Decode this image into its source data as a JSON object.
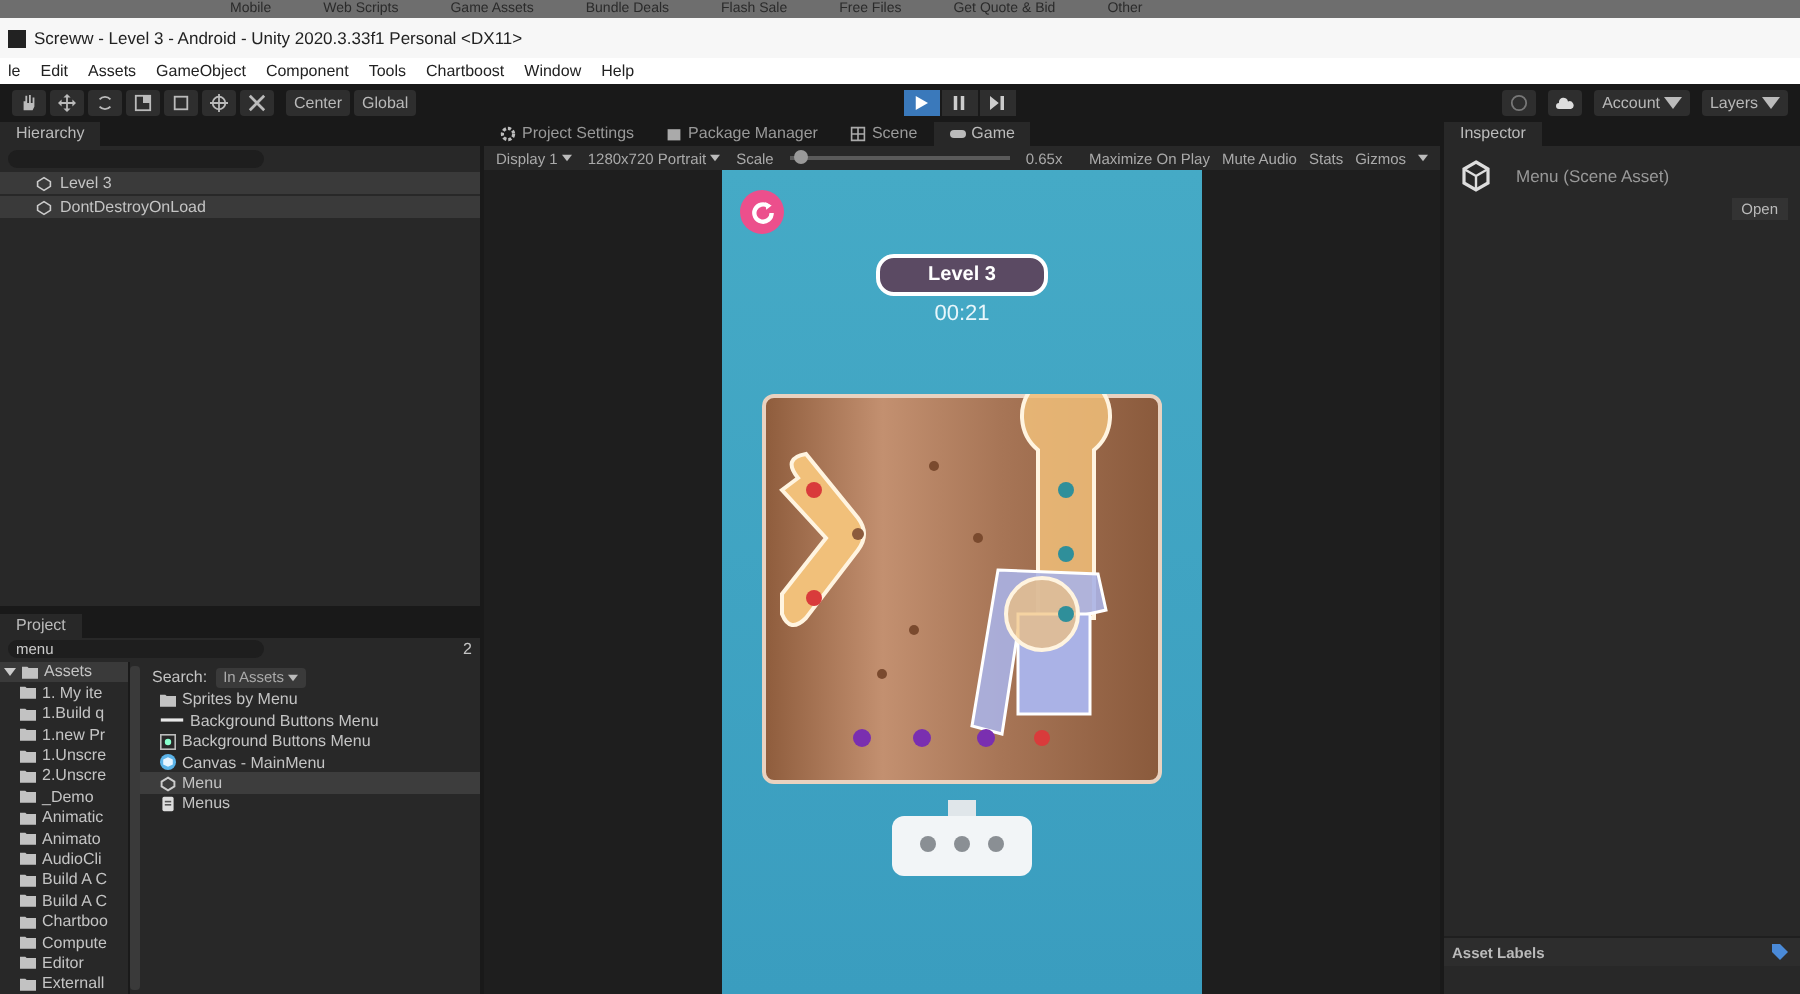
{
  "browser_bar": {
    "items": [
      "Mobile",
      "Web Scripts",
      "Game Assets",
      "Bundle Deals",
      "Flash Sale",
      "Free Files",
      "Get Quote & Bid",
      "Other"
    ]
  },
  "window": {
    "title": "Screww - Level 3 - Android - Unity 2020.3.33f1 Personal <DX11>"
  },
  "menu": [
    "le",
    "Edit",
    "Assets",
    "GameObject",
    "Component",
    "Tools",
    "Chartboost",
    "Window",
    "Help"
  ],
  "toolbar": {
    "pivot": "Center",
    "space": "Global",
    "playing": true,
    "account": "Account",
    "layers": "Layers"
  },
  "hierarchy": {
    "title": "Hierarchy",
    "items": [
      "Level 3",
      "DontDestroyOnLoad"
    ]
  },
  "game_view": {
    "tabs": [
      {
        "label": "Project Settings",
        "kind": "settings",
        "selected": false
      },
      {
        "label": "Package Manager",
        "kind": "package",
        "selected": false
      },
      {
        "label": "Scene",
        "kind": "scene",
        "selected": false
      },
      {
        "label": "Game",
        "kind": "game",
        "selected": true
      }
    ],
    "display": "Display 1",
    "resolution": "1280x720 Portrait",
    "scale_label": "Scale",
    "scale": {
      "level": 0.05
    },
    "scale_value": "0.65x",
    "toggles": [
      "Maximize On Play",
      "Mute Audio",
      "Stats",
      "Gizmos"
    ],
    "game": {
      "level_title": "Level 3",
      "timer": "00:21"
    }
  },
  "project": {
    "title": "Project",
    "search": "menu",
    "hidden_count": "2",
    "tree": {
      "label": "Assets",
      "expanded": true,
      "selected": true,
      "children": [
        {
          "label": "1. My ite",
          "selected": false
        },
        {
          "label": "1.Build q",
          "selected": false
        },
        {
          "label": "1.new Pr",
          "selected": false
        },
        {
          "label": "1.Unscre",
          "selected": false
        },
        {
          "label": "2.Unscre",
          "selected": false
        },
        {
          "label": "_Demo",
          "selected": false
        },
        {
          "label": "Animatic",
          "selected": false
        },
        {
          "label": "Animato",
          "selected": false
        },
        {
          "label": "AudioCli",
          "selected": false
        },
        {
          "label": "Build A C",
          "selected": false
        },
        {
          "label": "Build A C",
          "selected": false
        },
        {
          "label": "Chartboo",
          "selected": false
        },
        {
          "label": "Compute",
          "selected": false
        },
        {
          "label": "Editor",
          "selected": false
        },
        {
          "label": "Externall",
          "selected": false
        }
      ]
    },
    "search_label": "Search:",
    "search_scope": "In Assets",
    "results": [
      {
        "label": "Sprites by Menu",
        "kind": "folder",
        "selected": false
      },
      {
        "label": "Background Buttons Menu",
        "kind": "sprite",
        "selected": false
      },
      {
        "label": "Background Buttons Menu",
        "kind": "texture",
        "selected": false
      },
      {
        "label": "Canvas - MainMenu",
        "kind": "prefab",
        "selected": false
      },
      {
        "label": "Menu",
        "kind": "scene",
        "selected": true
      },
      {
        "label": "Menus",
        "kind": "file",
        "selected": false
      }
    ]
  },
  "inspector": {
    "title": "Inspector",
    "asset": "Menu (Scene Asset)",
    "open_button": "Open",
    "labels_title": "Asset Labels"
  }
}
